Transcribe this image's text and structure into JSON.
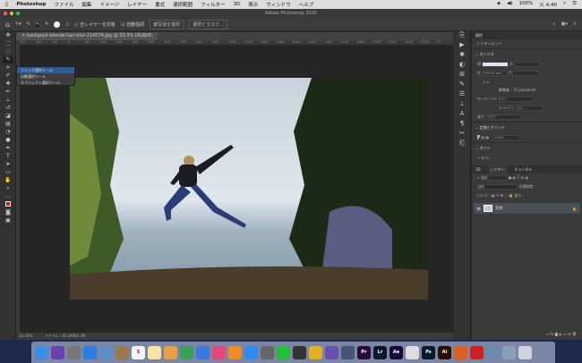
{
  "menubar": {
    "app": "Photoshop",
    "items": [
      "ファイル",
      "編集",
      "イメージ",
      "レイヤー",
      "書式",
      "選択範囲",
      "フィルター",
      "3D",
      "表示",
      "ウィンドウ",
      "ヘルプ"
    ],
    "battery": "100%",
    "clock": "火 4:40"
  },
  "window": {
    "title": "Adobe Photoshop 2020"
  },
  "options": {
    "sample_all": "全レイヤーを対象",
    "auto_enhance": "自動強調",
    "select_subject": "被写体を選択",
    "select_mask": "選択とマスク..."
  },
  "document": {
    "tab": "backpack-blonde-hair-blur-214574.jpg @ 33.3% (RGB/8)",
    "ruler": [
      "300",
      "200",
      "100",
      "0",
      "100",
      "200",
      "300",
      "400",
      "500",
      "600",
      "700",
      "800",
      "900",
      "1000",
      "1100",
      "1200",
      "1300",
      "1400",
      "1500",
      "1600",
      "1700",
      "1800",
      "1900",
      "2000",
      "2100",
      "2200",
      "23"
    ],
    "zoom": "33.33%",
    "file_info": "ファイル : 83.3M/83.3M"
  },
  "flyout": [
    "クイック選択ツール",
    "自動選択ツール",
    "オブジェクト選択ツール"
  ],
  "properties": {
    "tab": "属性",
    "doc": "ドキュメント",
    "canvas": "カンバス",
    "w_label": "W",
    "h_label": "H",
    "h_value": "1959.67 mm",
    "x_label": "X",
    "y_label": "Y",
    "resolution": "解像度 : 72 pixel/inch",
    "mode_label": "モード",
    "mode": "RGB カラー",
    "depth": "8 bit/チャンネル",
    "fill_label": "塗り",
    "fill": "マスク",
    "rulers_grid": "定規とグリッド",
    "zoom_pct": "100%",
    "guides": "ガイド"
  },
  "layers": {
    "tabs": [
      "3D",
      "レイヤー",
      "チャンネル"
    ],
    "search": "種類",
    "blend": "通常",
    "opacity_label": "不透明度 :",
    "lock_label": "ロック :",
    "fill_label": "塗り :",
    "layer_name": "背景"
  },
  "dock": [
    {
      "name": "Finder",
      "color": "#3b8ee8"
    },
    {
      "name": "Siri",
      "color": "#6a3fb0"
    },
    {
      "name": "Launchpad",
      "color": "#777"
    },
    {
      "name": "Safari",
      "color": "#2a7de1"
    },
    {
      "name": "Preview",
      "color": "#5c8fc7"
    },
    {
      "name": "Notes",
      "color": "#9a7a4a"
    },
    {
      "name": "5",
      "color": "#f4f4f4"
    },
    {
      "name": "Memo",
      "color": "#f3e6a0"
    },
    {
      "name": "Pages",
      "color": "#e8a040"
    },
    {
      "name": "Numbers",
      "color": "#3aa055"
    },
    {
      "name": "Keynote",
      "color": "#3a7ae0"
    },
    {
      "name": "iTunes",
      "color": "#e8457a"
    },
    {
      "name": "Books",
      "color": "#f08a24"
    },
    {
      "name": "App Store",
      "color": "#2a8cf0"
    },
    {
      "name": "Prefs",
      "color": "#666"
    },
    {
      "name": "LINE",
      "color": "#22c03a"
    },
    {
      "name": "QuickTime",
      "color": "#333"
    },
    {
      "name": "Chrome",
      "color": "#e0b020"
    },
    {
      "name": "Affinity",
      "color": "#6a4fb0"
    },
    {
      "name": "Vectorize",
      "color": "#445577"
    },
    {
      "name": "Pr",
      "color": "#2a0a3a"
    },
    {
      "name": "Lr",
      "color": "#0a1a2a"
    },
    {
      "name": "Ae",
      "color": "#1a0a3a"
    },
    {
      "name": "Docs",
      "color": "#ddd"
    },
    {
      "name": "Ps",
      "color": "#001a2a"
    },
    {
      "name": "Ai",
      "color": "#2a1000"
    },
    {
      "name": "Firefox",
      "color": "#e0601a"
    },
    {
      "name": "CC",
      "color": "#d02020"
    },
    {
      "name": "Photos",
      "color": "#6a8ab0"
    },
    {
      "name": "Gallery",
      "color": "#8aa0b8"
    },
    {
      "name": "Trash",
      "color": "#cfd4dc"
    }
  ]
}
